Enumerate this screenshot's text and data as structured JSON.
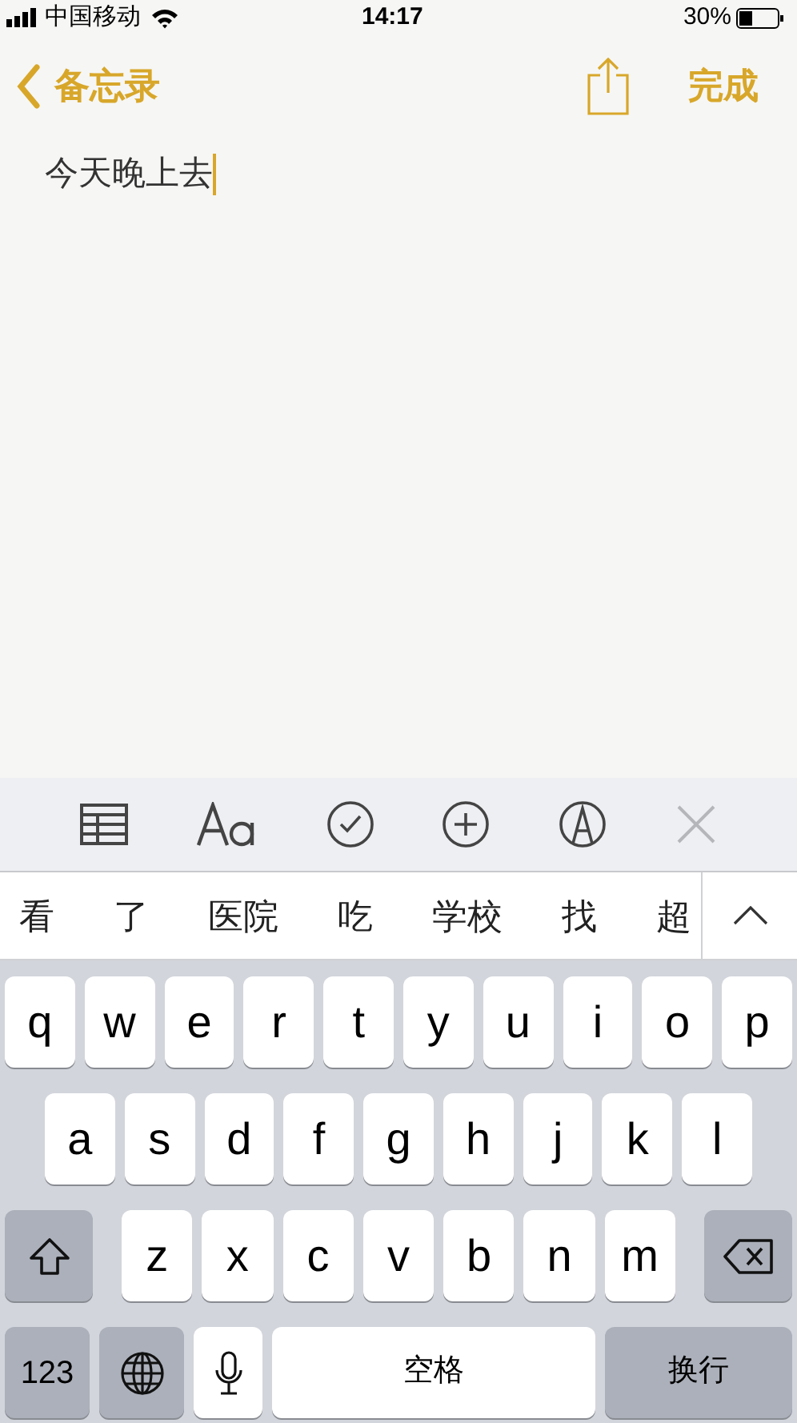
{
  "status_bar": {
    "carrier": "中国移动",
    "time": "14:17",
    "battery": "30%"
  },
  "nav": {
    "back_label": "备忘录",
    "done": "完成"
  },
  "note": {
    "text": "今天晚上去"
  },
  "candidates": [
    "看",
    "了",
    "医院",
    "吃",
    "学校",
    "找",
    "超"
  ],
  "keyboard": {
    "rows": [
      {
        "keys": [
          {
            "kind": "letter",
            "label": "q"
          },
          {
            "kind": "letter",
            "label": "w"
          },
          {
            "kind": "letter",
            "label": "e"
          },
          {
            "kind": "letter",
            "label": "r"
          },
          {
            "kind": "letter",
            "label": "t"
          },
          {
            "kind": "letter",
            "label": "y"
          },
          {
            "kind": "letter",
            "label": "u"
          },
          {
            "kind": "letter",
            "label": "i"
          },
          {
            "kind": "letter",
            "label": "o"
          },
          {
            "kind": "letter",
            "label": "p"
          }
        ]
      },
      {
        "keys": [
          {
            "kind": "letter",
            "label": "a"
          },
          {
            "kind": "letter",
            "label": "s"
          },
          {
            "kind": "letter",
            "label": "d"
          },
          {
            "kind": "letter",
            "label": "f"
          },
          {
            "kind": "letter",
            "label": "g"
          },
          {
            "kind": "letter",
            "label": "h"
          },
          {
            "kind": "letter",
            "label": "j"
          },
          {
            "kind": "letter",
            "label": "k"
          },
          {
            "kind": "letter",
            "label": "l"
          }
        ]
      },
      {
        "keys": [
          {
            "kind": "shift"
          },
          {
            "kind": "letter",
            "label": "z"
          },
          {
            "kind": "letter",
            "label": "x"
          },
          {
            "kind": "letter",
            "label": "c"
          },
          {
            "kind": "letter",
            "label": "v"
          },
          {
            "kind": "letter",
            "label": "b"
          },
          {
            "kind": "letter",
            "label": "n"
          },
          {
            "kind": "letter",
            "label": "m"
          },
          {
            "kind": "delete"
          }
        ]
      },
      {
        "keys": [
          {
            "kind": "numbers",
            "label": "123"
          },
          {
            "kind": "globe"
          },
          {
            "kind": "mic"
          },
          {
            "kind": "space",
            "label": "空格"
          },
          {
            "kind": "return",
            "label": "换行"
          }
        ]
      }
    ]
  }
}
